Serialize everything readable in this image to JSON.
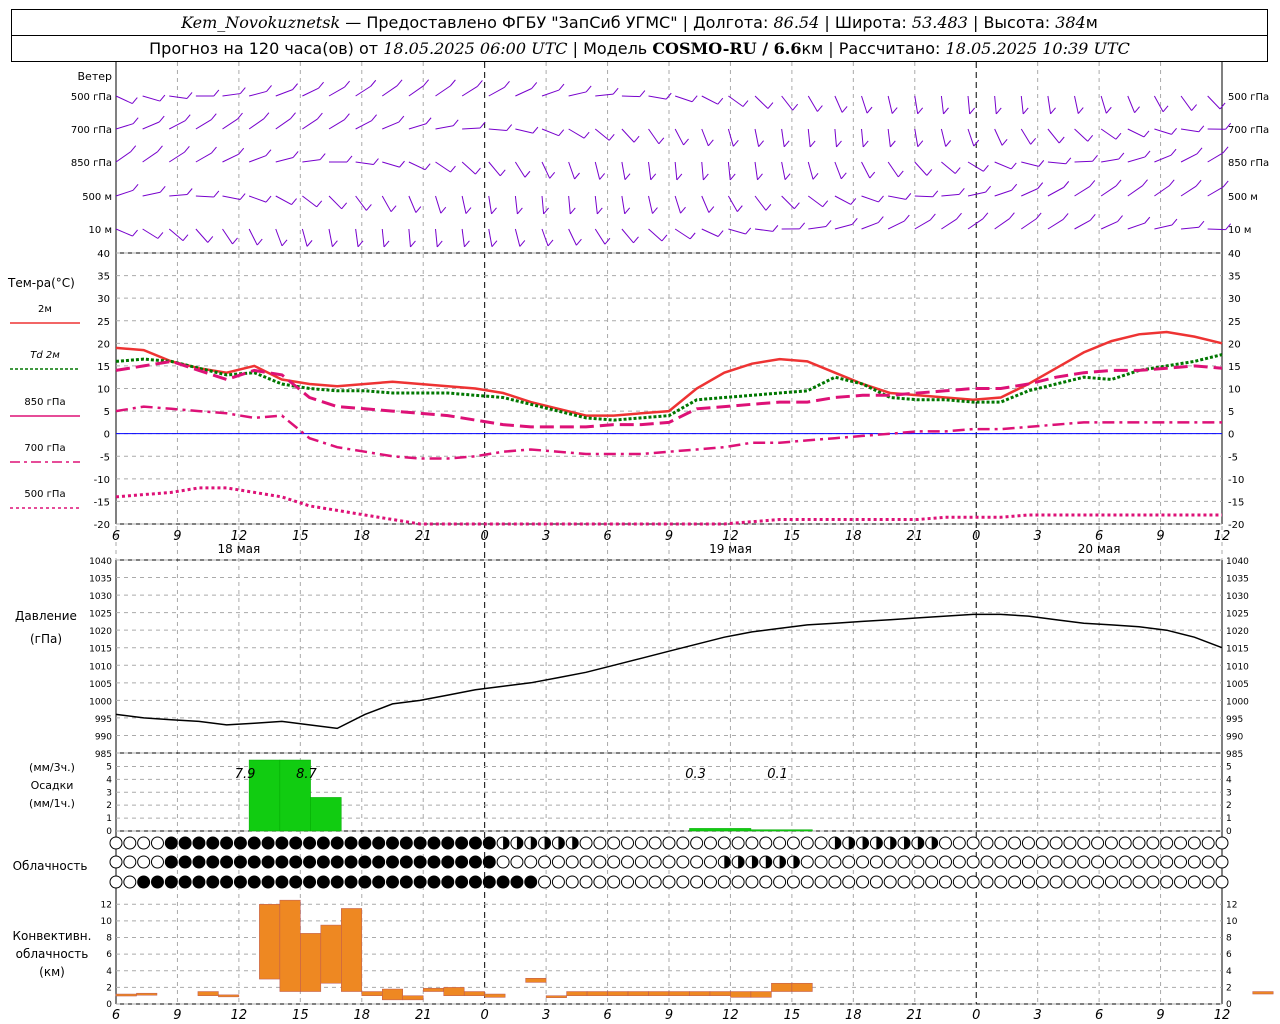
{
  "header": {
    "station": "Kem_Novokuznetsk",
    "provider": "— Предоставлено ФГБУ \"ЗапСиб УГМС\"",
    "lon_label": "Долгота:",
    "lon": "86.54",
    "lat_label": "Широта:",
    "lat": "53.483",
    "alt_label": "Высота:",
    "alt": "384",
    "alt_unit": "м",
    "forecast_prefix": "Прогноз на 120 часа(ов) от",
    "forecast_start": "18.05.2025 06:00 UTC",
    "model_label": "Модель",
    "model": "COSMO-RU / 6.6",
    "model_unit": "км",
    "computed_label": "Рассчитано:",
    "computed": "18.05.2025 10:39 UTC"
  },
  "labels": {
    "wind": "Ветер",
    "wind_levels": [
      "500 гПа",
      "700 гПа",
      "850 гПа",
      "500 м",
      "10  м"
    ],
    "temp_title": "Тем-ра(°C)",
    "legend": [
      "2м",
      "Td  2м",
      "850 гПа",
      "700 гПа",
      "500 гПа"
    ],
    "pressure_title": "Давление",
    "pressure_unit": "(гПа)",
    "precip_unit3": "(мм/3ч.)",
    "precip_title": "Осадки",
    "precip_unit1": "(мм/1ч.)",
    "cloud_title": "Облачность",
    "conv_title": [
      "Конвективн.",
      "облачность",
      "(км)"
    ],
    "dates": [
      "18 мая",
      "19 мая",
      "20 мая"
    ],
    "hours": [
      "6",
      "9",
      "12",
      "15",
      "18",
      "21",
      "0",
      "3",
      "6",
      "9",
      "12",
      "15",
      "18",
      "21",
      "0",
      "3",
      "6",
      "9",
      "12",
      "15",
      "18",
      "21",
      "0",
      "3",
      "6",
      "9",
      "12"
    ]
  },
  "colors": {
    "t2m": "#ee3333",
    "td2m": "#007700",
    "t850": "#dd1177",
    "t700": "#dd1177",
    "t500": "#dd1177",
    "wind": "#7700cc",
    "precip": "#11cc11",
    "conv": "#ee8822",
    "zero_line": "#0000ff"
  },
  "chart_data": [
    {
      "type": "line",
      "title": "Тем-ра(°C)",
      "x_hours": [
        0,
        3,
        6,
        9,
        12,
        15,
        18,
        21,
        24,
        27,
        30,
        33,
        36,
        39,
        42,
        45,
        48,
        51,
        54,
        57,
        60,
        63,
        66,
        69,
        72,
        75,
        78,
        81,
        84,
        87,
        90,
        93,
        96,
        99,
        102,
        105,
        108,
        111,
        114,
        117,
        120
      ],
      "ylim": [
        -20,
        40
      ],
      "series": [
        {
          "name": "2м",
          "values": [
            19,
            18.5,
            16,
            14.5,
            13.5,
            15,
            12,
            11,
            10.5,
            11,
            11.5,
            11,
            10.5,
            10,
            9,
            7,
            5.5,
            4,
            4,
            4.5,
            5,
            10,
            13.5,
            15.5,
            16.5,
            16,
            13.5,
            11,
            9,
            8.5,
            8,
            7.5,
            8,
            11,
            14.5,
            18,
            20.5,
            22,
            22.5,
            21.5,
            20
          ]
        },
        {
          "name": "Td 2м",
          "values": [
            16,
            16.5,
            16,
            14.5,
            13,
            13.5,
            11,
            10,
            9.5,
            9.5,
            9,
            9,
            9,
            8.5,
            8,
            6.5,
            5,
            3.5,
            3,
            3.5,
            4,
            7.5,
            8,
            8.5,
            9,
            9.5,
            12.5,
            11,
            8,
            7.5,
            7.5,
            7,
            7,
            9.5,
            11,
            12.5,
            12,
            14,
            15,
            16,
            17.5
          ]
        },
        {
          "name": "850 гПа",
          "values": [
            14,
            15,
            16,
            14,
            12,
            14,
            13,
            8,
            6,
            5.5,
            5,
            4.5,
            4,
            3,
            2,
            1.5,
            1.5,
            1.5,
            2,
            2,
            2.5,
            5.5,
            6,
            6.5,
            7,
            7,
            8,
            8.5,
            8.5,
            9,
            9.5,
            10,
            10,
            11,
            12.5,
            13.5,
            14,
            14,
            14.5,
            15,
            14.5
          ]
        },
        {
          "name": "700 гПа",
          "values": [
            5,
            6,
            5.5,
            5,
            4.5,
            3.5,
            4,
            -1,
            -3,
            -4,
            -5,
            -5.5,
            -5.5,
            -5,
            -4,
            -3.5,
            -4,
            -4.5,
            -4.5,
            -4.5,
            -4,
            -3.5,
            -3,
            -2,
            -2,
            -1.5,
            -1,
            -0.5,
            0,
            0.5,
            0.5,
            1,
            1,
            1.5,
            2,
            2.5,
            2.5,
            2.5,
            2.5,
            2.5,
            2.5
          ]
        },
        {
          "name": "500 гПа",
          "values": [
            -14,
            -13.5,
            -13,
            -12,
            -12,
            -13,
            -14,
            -16,
            -17,
            -18,
            -19,
            -20,
            -21,
            -22,
            -23,
            -24,
            -24,
            -23,
            -22,
            -21,
            -20.5,
            -20,
            -20,
            -19.5,
            -19,
            -19,
            -19,
            -19,
            -19,
            -19,
            -18.5,
            -18.5,
            -18.5,
            -18,
            -18,
            -18,
            -18,
            -18,
            -18,
            -18,
            -18
          ]
        }
      ]
    },
    {
      "type": "line",
      "title": "Давление",
      "ylabel": "(гПа)",
      "x_hours": [
        0,
        3,
        6,
        9,
        12,
        15,
        18,
        21,
        24,
        27,
        30,
        33,
        36,
        39,
        42,
        45,
        48,
        51,
        54,
        57,
        60,
        63,
        66,
        69,
        72,
        75,
        78,
        81,
        84,
        87,
        90,
        93,
        96,
        99,
        102,
        105,
        108,
        111,
        114,
        117,
        120
      ],
      "ylim": [
        985,
        1040
      ],
      "values": [
        996,
        995,
        994.5,
        994,
        993,
        993.5,
        994,
        993,
        992,
        996,
        999,
        1000,
        1001.5,
        1003,
        1004,
        1005,
        1006.5,
        1008,
        1010,
        1012,
        1014,
        1016,
        1018,
        1019.5,
        1020.5,
        1021.5,
        1022,
        1022.5,
        1023,
        1023.5,
        1024,
        1024.5,
        1024.5,
        1024,
        1023,
        1022,
        1021.5,
        1021,
        1020,
        1018,
        1015
      ]
    },
    {
      "type": "bar",
      "title": "Осадки",
      "ylabel": "(мм/3ч.)",
      "ylim": [
        0,
        5.5
      ],
      "bars": [
        {
          "x_hour": 6.5,
          "width_h": 1.5,
          "value": 5.5
        },
        {
          "x_hour": 8.0,
          "width_h": 1.5,
          "value": 5.5
        },
        {
          "x_hour": 9.5,
          "width_h": 1.5,
          "value": 2.6
        },
        {
          "x_hour": 28.0,
          "width_h": 3.0,
          "value": 0.2
        },
        {
          "x_hour": 31.0,
          "width_h": 3.0,
          "value": 0.1
        }
      ],
      "annotations": [
        {
          "x_hour": 6.3,
          "text": "7.9"
        },
        {
          "x_hour": 9.3,
          "text": "8.7"
        },
        {
          "x_hour": 28.3,
          "text": "0.3"
        },
        {
          "x_hour": 32.3,
          "text": "0.1"
        }
      ]
    },
    {
      "type": "bar",
      "title": "Конвективн. облачность",
      "ylabel": "(км)",
      "ylim": [
        0,
        13
      ],
      "bars": [
        {
          "x_hour": 0.5,
          "bottom": 1.0,
          "top": 1.2
        },
        {
          "x_hour": 1.5,
          "bottom": 1.1,
          "top": 1.3
        },
        {
          "x_hour": 4.5,
          "bottom": 1.0,
          "top": 1.5
        },
        {
          "x_hour": 5.5,
          "bottom": 1.0,
          "top": 1.1
        },
        {
          "x_hour": 7.5,
          "bottom": 3.0,
          "top": 12.0
        },
        {
          "x_hour": 8.5,
          "bottom": 1.5,
          "top": 12.5
        },
        {
          "x_hour": 9.5,
          "bottom": 1.5,
          "top": 8.5
        },
        {
          "x_hour": 10.5,
          "bottom": 2.5,
          "top": 9.5
        },
        {
          "x_hour": 11.5,
          "bottom": 1.5,
          "top": 11.5
        },
        {
          "x_hour": 12.5,
          "bottom": 1.0,
          "top": 1.5
        },
        {
          "x_hour": 13.5,
          "bottom": 0.5,
          "top": 1.8
        },
        {
          "x_hour": 14.5,
          "bottom": 0.5,
          "top": 1.0
        },
        {
          "x_hour": 15.5,
          "bottom": 1.5,
          "top": 1.9
        },
        {
          "x_hour": 16.5,
          "bottom": 1.0,
          "top": 2.0
        },
        {
          "x_hour": 17.5,
          "bottom": 1.0,
          "top": 1.5
        },
        {
          "x_hour": 18.5,
          "bottom": 0.8,
          "top": 1.2
        },
        {
          "x_hour": 20.5,
          "bottom": 2.6,
          "top": 3.1
        },
        {
          "x_hour": 21.5,
          "bottom": 0.8,
          "top": 1.0
        },
        {
          "x_hour": 22.5,
          "bottom": 1.0,
          "top": 1.5
        },
        {
          "x_hour": 23.5,
          "bottom": 1.0,
          "top": 1.5
        },
        {
          "x_hour": 24.5,
          "bottom": 1.0,
          "top": 1.5
        },
        {
          "x_hour": 25.5,
          "bottom": 1.0,
          "top": 1.5
        },
        {
          "x_hour": 26.5,
          "bottom": 1.0,
          "top": 1.5
        },
        {
          "x_hour": 27.5,
          "bottom": 1.0,
          "top": 1.5
        },
        {
          "x_hour": 28.5,
          "bottom": 1.0,
          "top": 1.5
        },
        {
          "x_hour": 29.5,
          "bottom": 1.0,
          "top": 1.5
        },
        {
          "x_hour": 30.5,
          "bottom": 0.8,
          "top": 1.5
        },
        {
          "x_hour": 31.5,
          "bottom": 0.8,
          "top": 1.5
        },
        {
          "x_hour": 32.5,
          "bottom": 1.5,
          "top": 2.5
        },
        {
          "x_hour": 33.5,
          "bottom": 1.5,
          "top": 2.5
        },
        {
          "x_hour": 56.0,
          "bottom": 1.2,
          "top": 1.5
        }
      ]
    }
  ]
}
